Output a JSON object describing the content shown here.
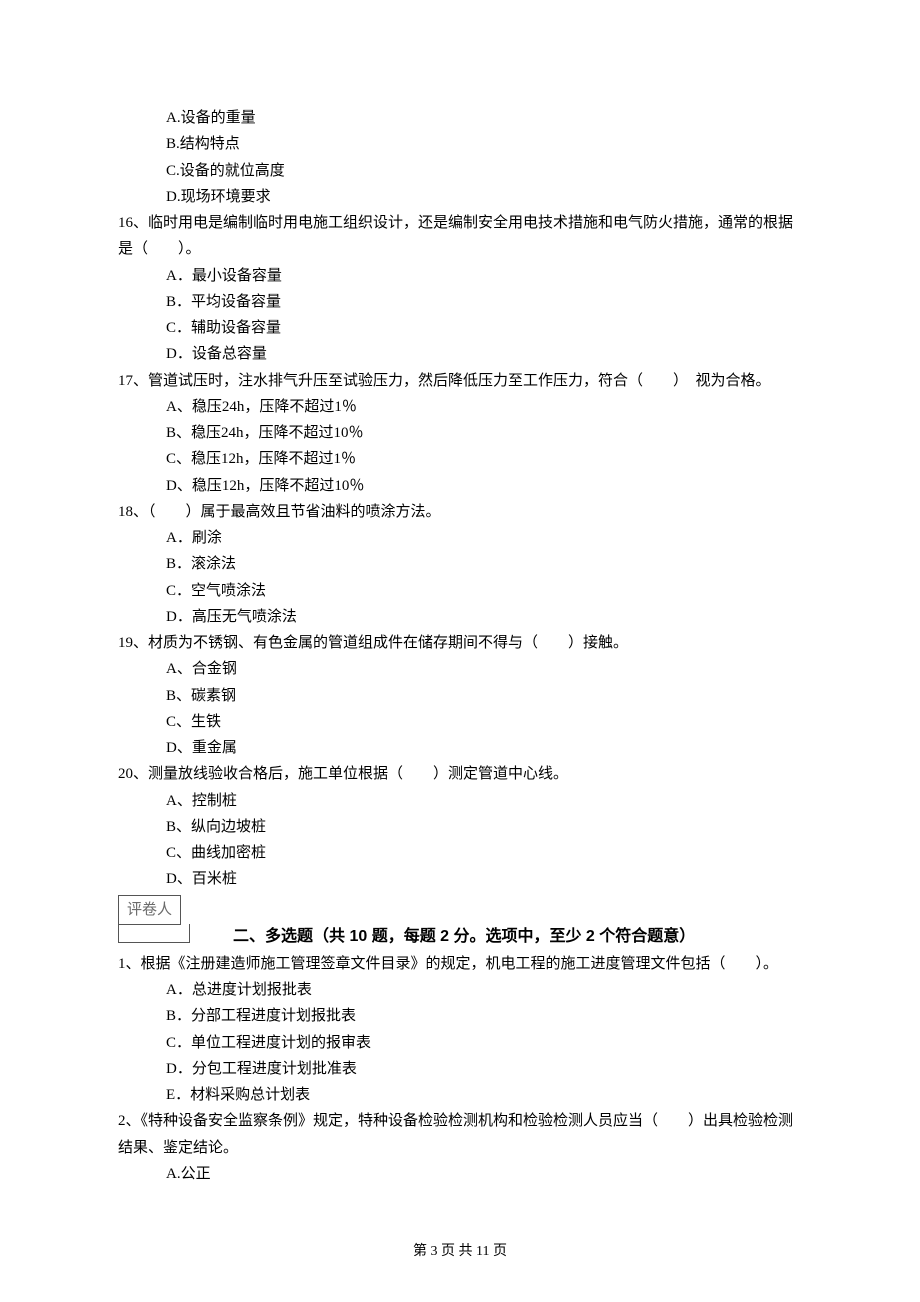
{
  "q15": {
    "A": "A.设备的重量",
    "B": "B.结构特点",
    "C": "C.设备的就位高度",
    "D": "D.现场环境要求"
  },
  "q16": {
    "text": "16、临时用电是编制临时用电施工组织设计，还是编制安全用电技术措施和电气防火措施，通常的根据是（　　）。",
    "A": "A．最小设备容量",
    "B": "B．平均设备容量",
    "C": "C．辅助设备容量",
    "D": "D．设备总容量"
  },
  "q17": {
    "text": "17、管道试压时，注水排气升压至试验压力，然后降低压力至工作压力，符合（　　）　视为合格。",
    "A": "A、稳压24h，压降不超过1％",
    "B": "B、稳压24h，压降不超过10％",
    "C": "C、稳压12h，压降不超过1％",
    "D": "D、稳压12h，压降不超过10％"
  },
  "q18": {
    "text": "18、（　　）属于最高效且节省油料的喷涂方法。",
    "A": "A．刷涂",
    "B": "B．滚涂法",
    "C": "C．空气喷涂法",
    "D": "D．高压无气喷涂法"
  },
  "q19": {
    "text": "19、材质为不锈钢、有色金属的管道组成件在储存期间不得与（　　）接触。",
    "A": "A、合金钢",
    "B": "B、碳素钢",
    "C": "C、生铁",
    "D": "D、重金属"
  },
  "q20": {
    "text": "20、测量放线验收合格后，施工单位根据（　　）测定管道中心线。",
    "A": "A、控制桩",
    "B": "B、纵向边坡桩",
    "C": "C、曲线加密桩",
    "D": "D、百米桩"
  },
  "grader_label": "评卷人",
  "section2_heading": "二、多选题（共 10 题，每题 2 分。选项中，至少 2 个符合题意）",
  "mq1": {
    "text": "1、根据《注册建造师施工管理签章文件目录》的规定，机电工程的施工进度管理文件包括（　　）。",
    "A": "A．总进度计划报批表",
    "B": "B．分部工程进度计划报批表",
    "C": "C．单位工程进度计划的报审表",
    "D": "D．分包工程进度计划批准表",
    "E": "E．材料采购总计划表"
  },
  "mq2": {
    "text": "2、《特种设备安全监察条例》规定，特种设备检验检测机构和检验检测人员应当（　　）出具检验检测结果、鉴定结论。",
    "A": "A.公正"
  },
  "footer": "第 3 页 共 11 页"
}
